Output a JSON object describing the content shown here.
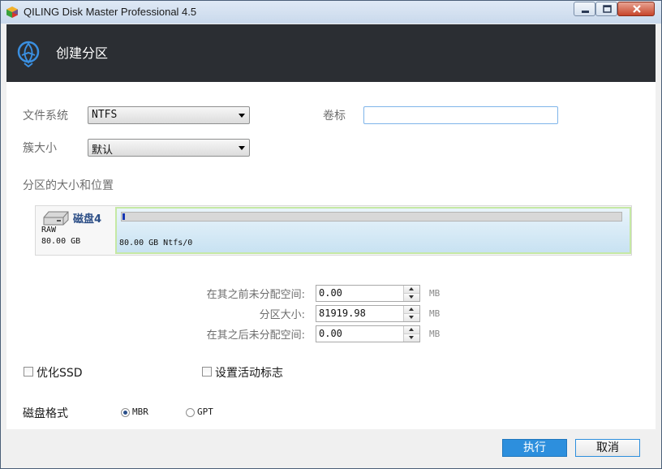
{
  "window": {
    "title": "QILING Disk Master Professional 4.5"
  },
  "header": {
    "title": "创建分区"
  },
  "form": {
    "file_system_label": "文件系统",
    "file_system_value": "NTFS",
    "volume_label": "卷标",
    "volume_value": "",
    "cluster_size_label": "簇大小",
    "cluster_size_value": "默认"
  },
  "partition_section": {
    "title": "分区的大小和位置",
    "disk_name": "磁盘4",
    "disk_type": "RAW",
    "disk_size": "80.00 GB",
    "partition_label": "80.00 GB Ntfs/0",
    "used_fraction": 0.005
  },
  "sizes": {
    "unallocated_before_label": "在其之前未分配空间:",
    "unallocated_before_value": "0.00",
    "partition_size_label": "分区大小:",
    "partition_size_value": "81919.98",
    "unallocated_after_label": "在其之后未分配空间:",
    "unallocated_after_value": "0.00",
    "unit": "MB"
  },
  "options": {
    "optimize_ssd_label": "优化SSD",
    "optimize_ssd_checked": false,
    "set_active_label": "设置活动标志",
    "set_active_checked": false
  },
  "disk_format": {
    "label": "磁盘格式",
    "options": [
      "MBR",
      "GPT"
    ],
    "selected": "MBR"
  },
  "buttons": {
    "execute": "执行",
    "cancel": "取消"
  },
  "colors": {
    "header_bg": "#2b2e33",
    "accent": "#2d8fdd",
    "disk_name": "#2c4e86",
    "usage_fill": "#1736b2"
  },
  "icons": {
    "app": "cube-icon",
    "logo": "qiling-logo-icon",
    "disk": "hard-disk-icon"
  }
}
